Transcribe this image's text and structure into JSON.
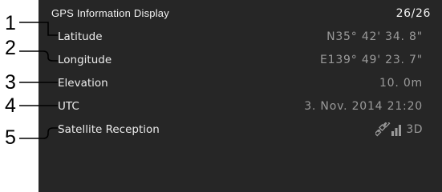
{
  "header": {
    "title": "GPS Information Display",
    "page_indicator": "26/26"
  },
  "rows": [
    {
      "number": "1",
      "label": "Latitude",
      "value": "N35° 42' 34. 8\""
    },
    {
      "number": "2",
      "label": "Longitude",
      "value": "E139° 49' 23. 7\""
    },
    {
      "number": "3",
      "label": "Elevation",
      "value": "10. 0m"
    },
    {
      "number": "4",
      "label": "UTC",
      "value": "3. Nov. 2014  21:20"
    },
    {
      "number": "5",
      "label": "Satellite Reception",
      "value": "3D",
      "icon": "satellite-signal-icon"
    }
  ],
  "colors": {
    "screen_bg": "#262626",
    "label_text": "#ececec",
    "value_text": "#9a9a9a",
    "callout_line": "#000000"
  }
}
